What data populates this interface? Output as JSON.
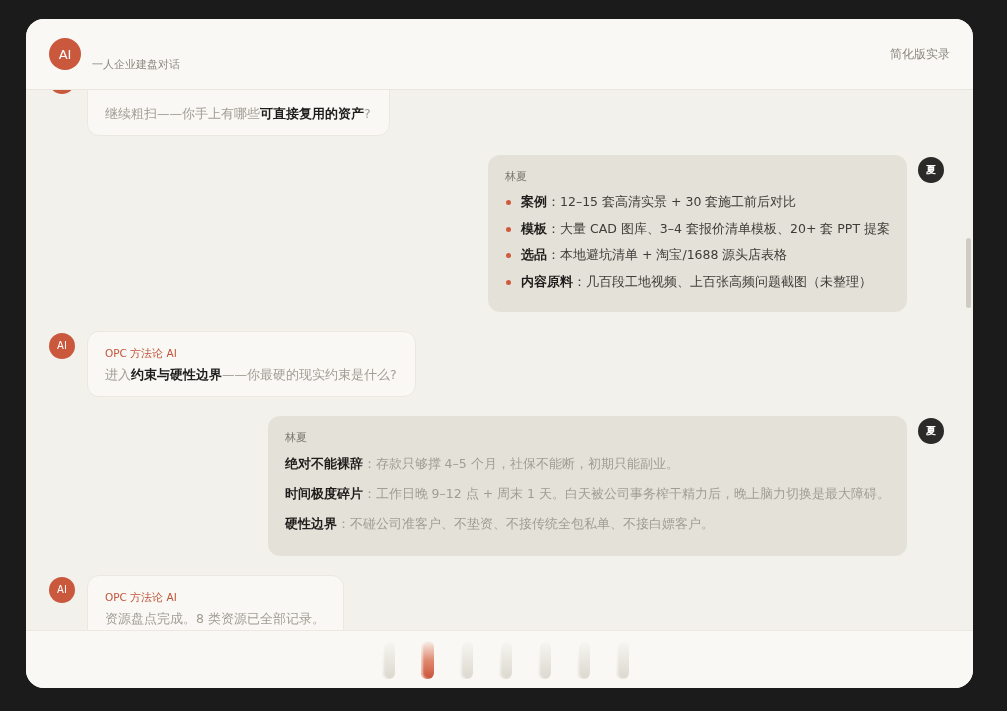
{
  "header": {
    "avatar": "AI",
    "subtitle": "一人企业建盘对话",
    "mode": "简化版实录"
  },
  "messages": [
    {
      "kind": "ai",
      "clipped_top": true,
      "text": "继续粗扫——你手上有哪些**可直接复用的资产**?"
    },
    {
      "kind": "user",
      "avatar": "夏",
      "sender": "林夏",
      "items": [
        {
          "kind": "bullet",
          "text": "**案例**：12–15 套高清实景 + 30 套施工前后对比"
        },
        {
          "kind": "bullet",
          "text": "**模板**：大量 CAD 图库、3–4 套报价清单模板、20+ 套 PPT 提案"
        },
        {
          "kind": "bullet",
          "text": "**选品**：本地避坑清单 + 淘宝/1688 源头店表格"
        },
        {
          "kind": "bullet",
          "text": "**内容原料**：几百段工地视频、上百张高频问题截图（未整理）"
        }
      ]
    },
    {
      "kind": "ai",
      "avatar": "AI",
      "sender": "OPC 方法论 AI",
      "text": "进入**约束与硬性边界**——你最硬的现实约束是什么?"
    },
    {
      "kind": "user",
      "avatar": "夏",
      "sender": "林夏",
      "items": [
        {
          "kind": "plain",
          "text": "**绝对不能裸辞**：存款只够撑 4–5 个月，社保不能断，初期只能副业。"
        },
        {
          "kind": "plain",
          "text": "**时间极度碎片**：工作日晚 9–12 点 + 周末 1 天。白天被公司事务榨干精力后，晚上脑力切换是最大障碍。"
        },
        {
          "kind": "plain",
          "text": "**硬性边界**：不碰公司准客户、不垫资、不接传统全包私单、不接白嫖客户。"
        }
      ]
    },
    {
      "kind": "ai",
      "avatar": "AI",
      "sender": "OPC 方法论 AI",
      "text": "资源盘点完成。8 类资源已全部记录。"
    }
  ],
  "steps": [
    {
      "selected": false
    },
    {
      "selected": true
    },
    {
      "selected": false
    },
    {
      "selected": false
    },
    {
      "selected": false
    },
    {
      "selected": false
    },
    {
      "selected": false
    }
  ]
}
